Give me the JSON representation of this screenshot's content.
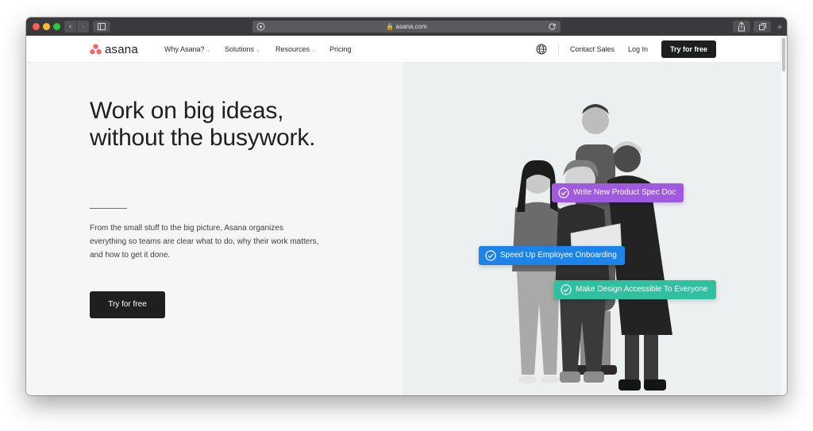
{
  "browser": {
    "url": "asana.com"
  },
  "nav": {
    "logo_text": "asana",
    "items": [
      {
        "label": "Why Asana?",
        "has_dropdown": true
      },
      {
        "label": "Solutions",
        "has_dropdown": true
      },
      {
        "label": "Resources",
        "has_dropdown": true
      },
      {
        "label": "Pricing",
        "has_dropdown": false
      }
    ],
    "contact_sales": "Contact Sales",
    "log_in": "Log In",
    "cta": "Try for free"
  },
  "hero": {
    "headline_line1": "Work on big ideas,",
    "headline_line2": "without the busywork.",
    "body": "From the small stuff to the big picture, Asana organizes everything so teams are clear what to do, why their work matters, and how to get it done.",
    "cta": "Try for free"
  },
  "tasks": [
    {
      "label": "Write New Product Spec Doc",
      "color": "#a05ae2"
    },
    {
      "label": "Speed Up Employee Onboarding",
      "color": "#1d83e8"
    },
    {
      "label": "Make Design Accessible To Everyone",
      "color": "#2fc0a0"
    }
  ],
  "colors": {
    "brand_coral": "#f06a6a",
    "dark": "#1e1f21",
    "hero_left_bg": "#f6f6f6",
    "hero_right_bg": "#edf0f1"
  }
}
